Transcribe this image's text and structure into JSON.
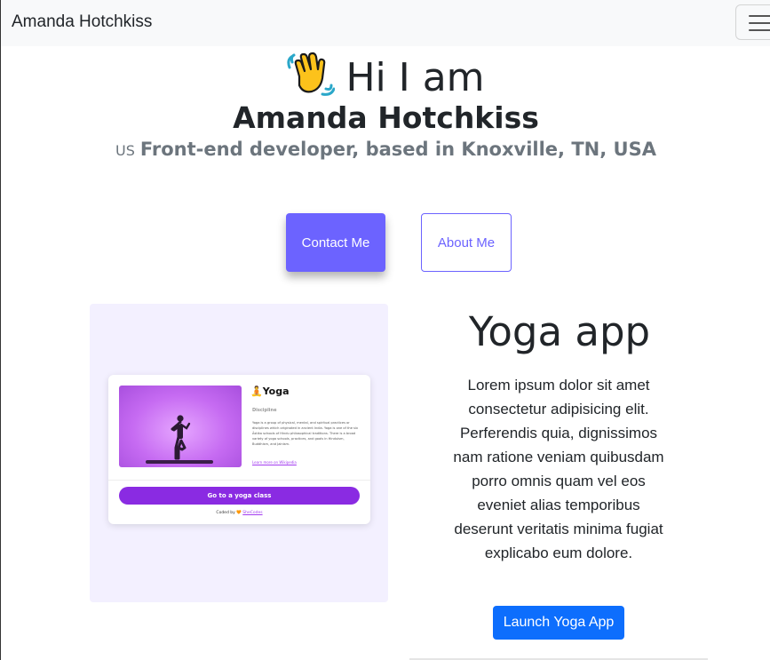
{
  "navbar": {
    "brand": "Amanda Hotchkiss",
    "toggler_icon": "hamburger-icon"
  },
  "hero": {
    "greeting": "Hi I am",
    "wave_icon": "waving-hand-icon",
    "name": "Amanda Hotchkiss",
    "flag_code": "US",
    "subtitle": "Front-end developer, based in Knoxville, TN, USA"
  },
  "buttons": {
    "contact": "Contact Me",
    "about": "About Me"
  },
  "project": {
    "title": "Yoga app",
    "description": "Lorem ipsum dolor sit amet consectetur adipisicing elit. Perferendis quia, dignissimos nam ratione veniam quibusdam porro omnis quam vel eos eveniet alias temporibus deserunt veritatis minima fugiat explicabo eum dolore.",
    "launch_label": "Launch Yoga App",
    "preview": {
      "app_title": "Yoga",
      "app_icon": "yoga-person-icon",
      "label": "Discipline",
      "text": "Yoga is a group of physical, mental, and spiritual practices or disciplines which originated in ancient India. Yoga is one of the six Āstika schools of Hindu philosophical traditions. There is a broad variety of yoga schools, practices, and goals in Hinduism, Buddhism, and Jainism.",
      "link": "Learn more on Wikipedia",
      "class_button": "Go to a yoga class",
      "credit_prefix": "Coded by",
      "credit_link": "SheCodes"
    }
  },
  "colors": {
    "accent": "#6c63ff",
    "launch": "#0d6efd",
    "preview_bg": "#f3f0ff",
    "yoga_purple": "#8a2be2"
  }
}
